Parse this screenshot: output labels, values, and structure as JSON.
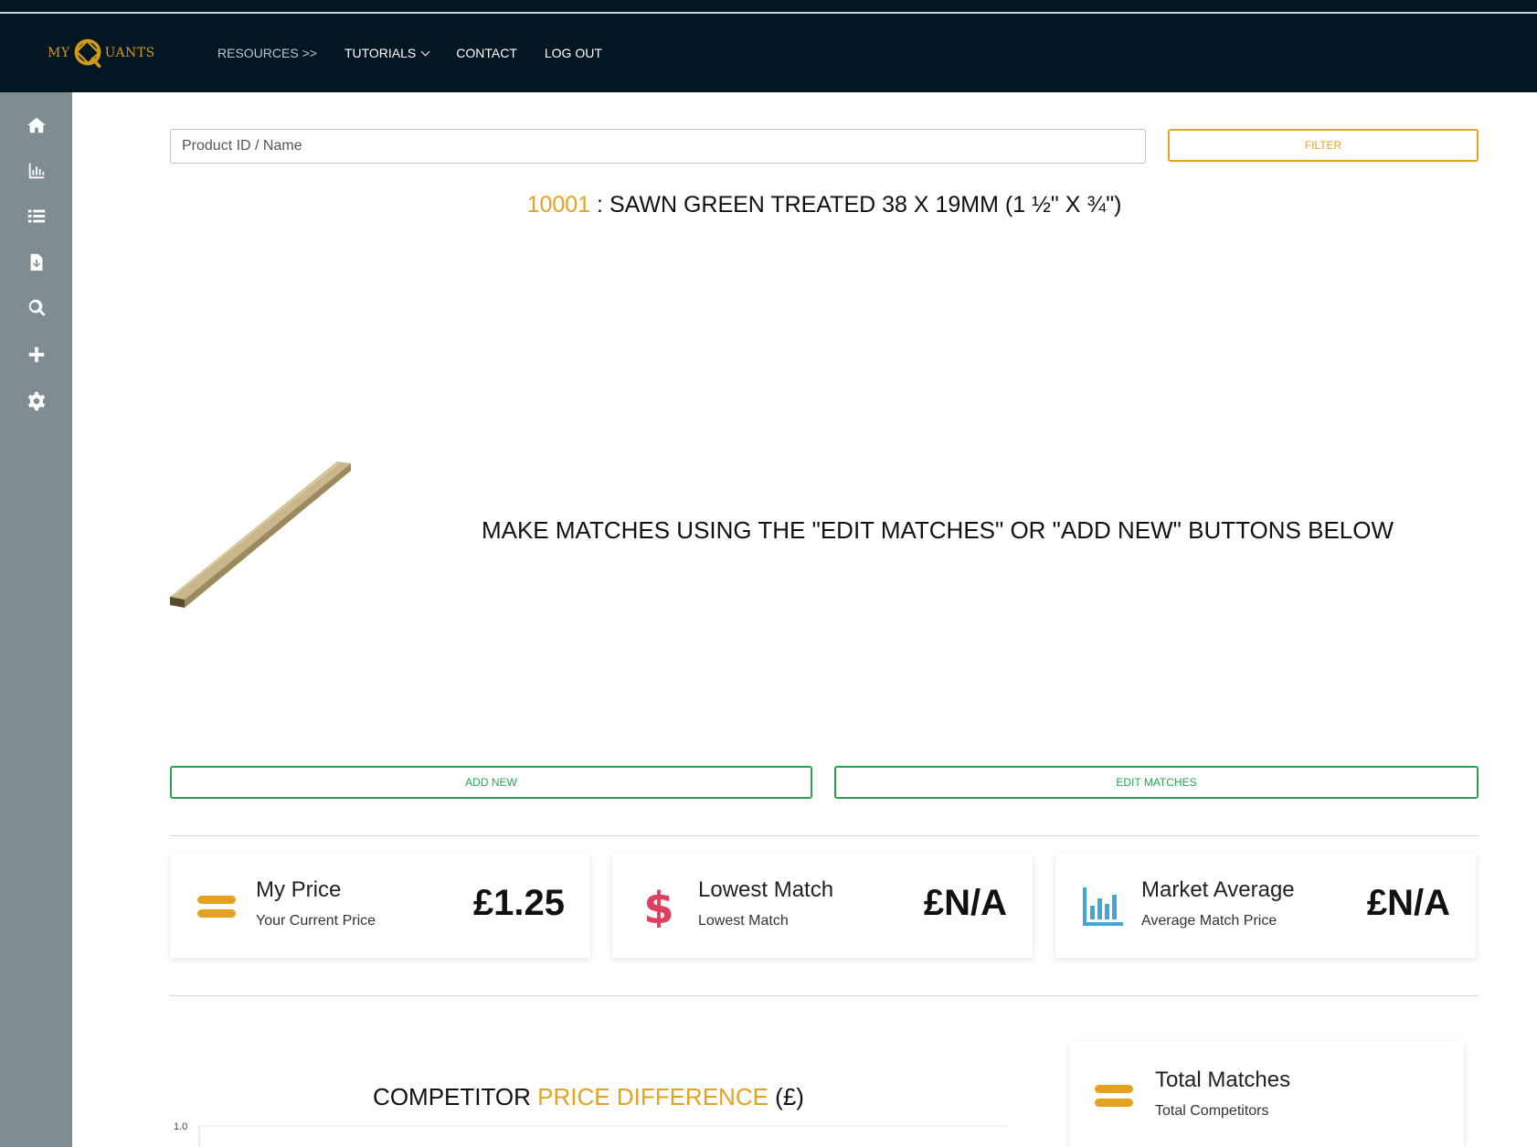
{
  "header": {
    "logo_left": "MY",
    "logo_right": "UANTS",
    "nav": {
      "resources": "RESOURCES >>",
      "tutorials": "TUTORIALS",
      "contact": "CONTACT",
      "logout": "LOG OUT"
    }
  },
  "sidebar": {
    "icons": [
      "home-icon",
      "bar-chart-icon",
      "list-icon",
      "file-download-icon",
      "search-icon",
      "plus-icon",
      "gear-icon"
    ]
  },
  "search": {
    "placeholder": "Product ID / Name",
    "filter_label": "FILTER"
  },
  "product": {
    "id": "10001",
    "separator": " : ",
    "name": "SAWN GREEN TREATED 38 X 19MM (1 ½\" X ¾\")"
  },
  "message": "MAKE MATCHES USING THE \"EDIT MATCHES\" OR \"ADD NEW\" BUTTONS BELOW",
  "buttons": {
    "add_new": "ADD NEW",
    "edit_matches": "EDIT MATCHES"
  },
  "stats": {
    "my_price": {
      "title": "My Price",
      "sub": "Your Current Price",
      "value": "£1.25"
    },
    "lowest_match": {
      "title": "Lowest Match",
      "sub": "Lowest Match",
      "value": "£N/A"
    },
    "market_average": {
      "title": "Market Average",
      "sub": "Average Match Price",
      "value": "£N/A"
    },
    "total_matches": {
      "title": "Total Matches",
      "sub": "Total Competitors"
    }
  },
  "colors": {
    "accent": "#e5a21f",
    "green": "#23a455",
    "navy": "#031722",
    "sidebar": "#7f8d91",
    "dollar": "#e0405f",
    "chart_blue": "#3fa9d6"
  },
  "chart_data": {
    "type": "bar",
    "title_parts": [
      "COMPETITOR ",
      "PRICE DIFFERENCE",
      " (£)"
    ],
    "categories": [],
    "values": [],
    "yticks": [
      "1.0"
    ],
    "ylim": [
      0,
      1.0
    ],
    "grid": true
  }
}
